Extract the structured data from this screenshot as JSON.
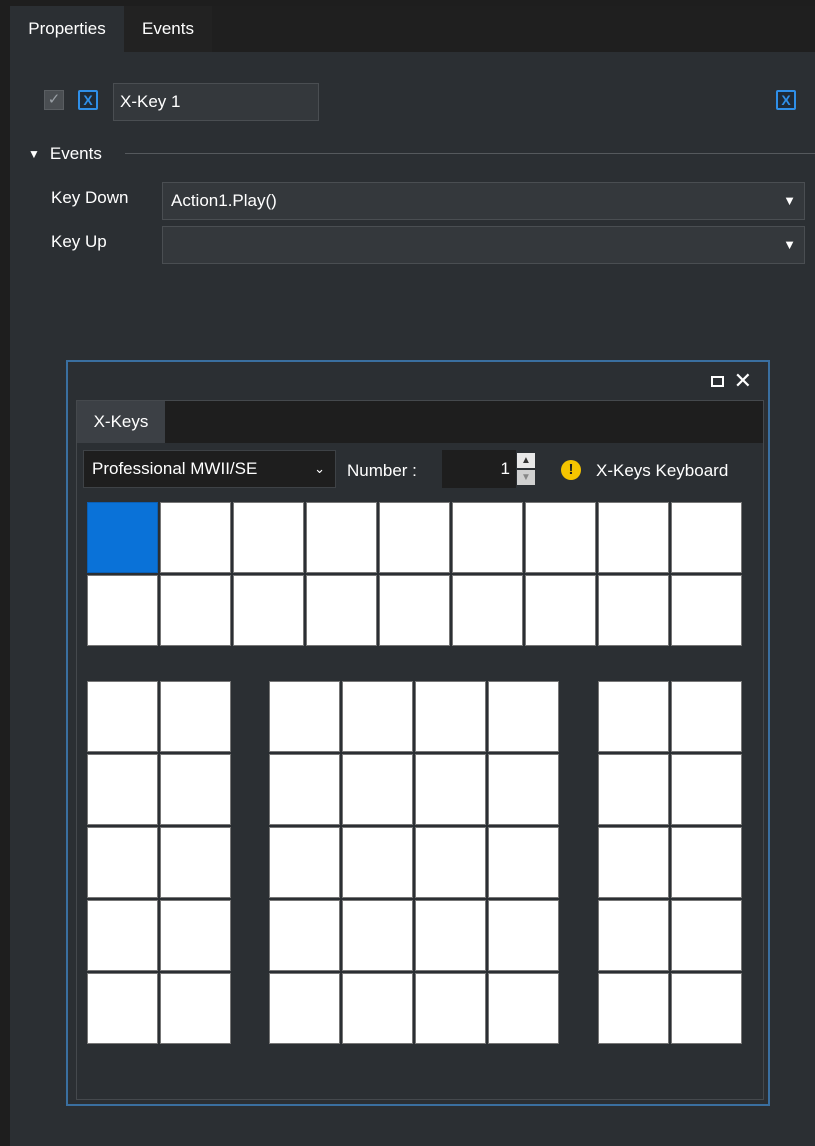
{
  "tabs": {
    "properties": "Properties",
    "events": "Events"
  },
  "header": {
    "name_value": "X-Key 1"
  },
  "events_section": {
    "title": "Events",
    "key_down_label": "Key Down",
    "key_down_value": "Action1.Play()",
    "key_up_label": "Key Up",
    "key_up_value": ""
  },
  "window": {
    "tab_label": "X-Keys",
    "model_select": "Professional MWII/SE",
    "number_label": "Number :",
    "number_value": "1",
    "warning_text": "X-Keys Keyboard"
  },
  "keyboard": {
    "top_rows": 2,
    "top_cols": 9,
    "bottom_rows": 5,
    "left_block_cols": 2,
    "middle_block_cols": 4,
    "right_block_cols": 2,
    "selected_key": "top-row-1-col-1"
  },
  "colors": {
    "accent": "#2f8fe8",
    "selected_key": "#0a72d8",
    "warning": "#f5c400",
    "panel_bg": "#2b2f33"
  },
  "icons": {
    "checkbox": "check-icon",
    "clear": "x-box-icon",
    "collapse": "chevron-down-icon",
    "dropdown": "chevron-down-icon",
    "maximize": "maximize-icon",
    "close": "close-icon",
    "warning": "warning-icon"
  }
}
